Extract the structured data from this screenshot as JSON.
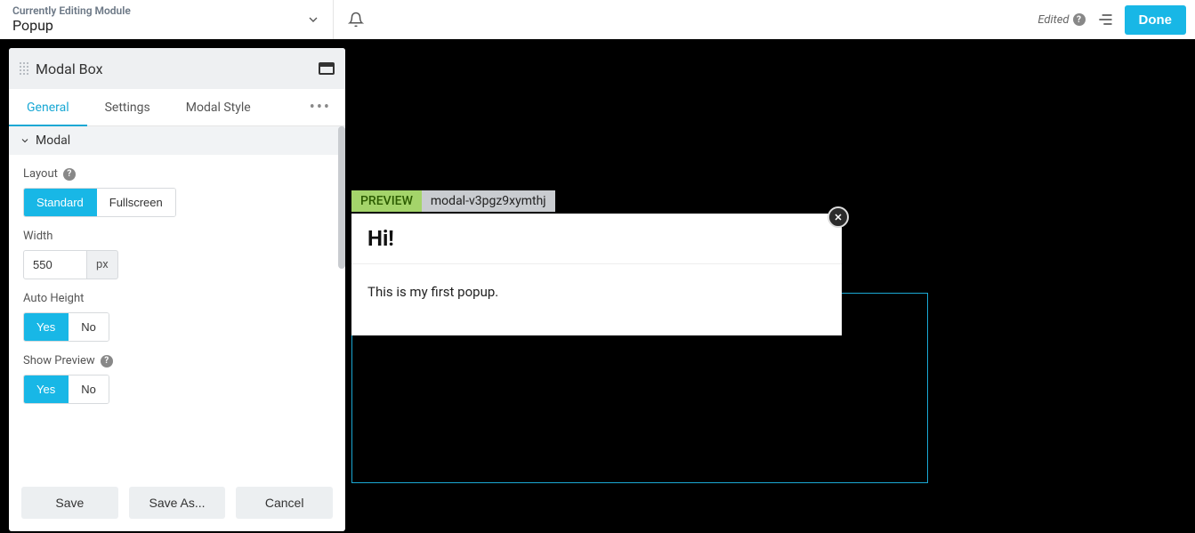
{
  "topbar": {
    "module_label": "Currently Editing Module",
    "module_name": "Popup",
    "edited_label": "Edited",
    "done_label": "Done"
  },
  "inspector": {
    "title": "Modal Box",
    "tabs": [
      "General",
      "Settings",
      "Modal Style"
    ],
    "active_tab": 0,
    "section_title": "Modal",
    "fields": {
      "layout": {
        "label": "Layout",
        "options": [
          "Standard",
          "Fullscreen"
        ],
        "selected": 0
      },
      "width": {
        "label": "Width",
        "value": "550",
        "unit": "px"
      },
      "auto_height": {
        "label": "Auto Height",
        "options": [
          "Yes",
          "No"
        ],
        "selected": 0
      },
      "show_preview": {
        "label": "Show Preview",
        "options": [
          "Yes",
          "No"
        ],
        "selected": 0
      }
    },
    "footer": {
      "save": "Save",
      "save_as": "Save As...",
      "cancel": "Cancel"
    }
  },
  "canvas": {
    "preview_badge": "PREVIEW",
    "modal_id": "modal-v3pgz9xymthj",
    "modal_title": "Hi!",
    "modal_body": "This is my first popup."
  }
}
